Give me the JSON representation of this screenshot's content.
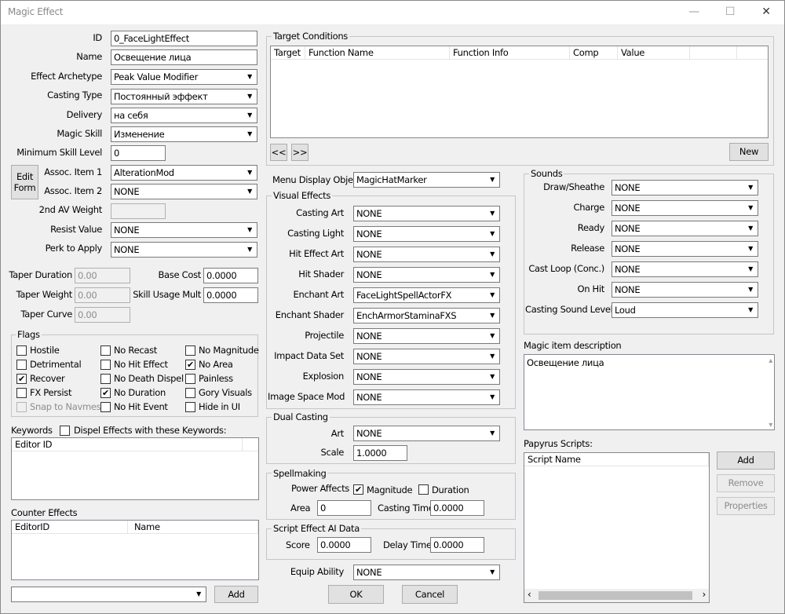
{
  "window": {
    "title": "Magic Effect",
    "minimize": "—",
    "maximize": "☐",
    "close": "✕"
  },
  "left": {
    "id_label": "ID",
    "id_value": "0_FaceLightEffect",
    "name_label": "Name",
    "name_value": "Освещение лица",
    "archetype_label": "Effect Archetype",
    "archetype_value": "Peak Value Modifier",
    "casting_type_label": "Casting Type",
    "casting_type_value": "Постоянный эффект",
    "delivery_label": "Delivery",
    "delivery_value": "на себя",
    "magic_skill_label": "Magic Skill",
    "magic_skill_value": "Изменение",
    "min_skill_label": "Minimum Skill Level",
    "min_skill_value": "0",
    "edit_form_line1": "Edit",
    "edit_form_line2": "Form",
    "assoc1_label": "Assoc. Item 1",
    "assoc1_value": "AlterationMod",
    "assoc2_label": "Assoc. Item 2",
    "assoc2_value": "NONE",
    "av_weight_label": "2nd AV Weight",
    "av_weight_value": "",
    "resist_label": "Resist Value",
    "resist_value": "NONE",
    "perk_label": "Perk to Apply",
    "perk_value": "NONE",
    "taper_duration_label": "Taper Duration",
    "taper_duration_value": "0.00",
    "taper_weight_label": "Taper Weight",
    "taper_weight_value": "0.00",
    "taper_curve_label": "Taper Curve",
    "taper_curve_value": "0.00",
    "base_cost_label": "Base Cost",
    "base_cost_value": "0.0000",
    "skill_mult_label": "Skill Usage Mult",
    "skill_mult_value": "0.0000"
  },
  "flags": {
    "title": "Flags",
    "items": [
      {
        "label": "Hostile",
        "checked": false,
        "disabled": false
      },
      {
        "label": "No Recast",
        "checked": false,
        "disabled": false
      },
      {
        "label": "No Magnitude",
        "checked": false,
        "disabled": false
      },
      {
        "label": "Detrimental",
        "checked": false,
        "disabled": false
      },
      {
        "label": "No Hit Effect",
        "checked": false,
        "disabled": false
      },
      {
        "label": "No Area",
        "checked": true,
        "disabled": false
      },
      {
        "label": "Recover",
        "checked": true,
        "disabled": false
      },
      {
        "label": "No Death Dispel",
        "checked": false,
        "disabled": false
      },
      {
        "label": "Painless",
        "checked": false,
        "disabled": false
      },
      {
        "label": "FX Persist",
        "checked": false,
        "disabled": false
      },
      {
        "label": "No Duration",
        "checked": true,
        "disabled": false
      },
      {
        "label": "Gory Visuals",
        "checked": false,
        "disabled": false
      },
      {
        "label": "Snap to Navmesh",
        "checked": false,
        "disabled": true
      },
      {
        "label": "No Hit Event",
        "checked": false,
        "disabled": false
      },
      {
        "label": "Hide in UI",
        "checked": false,
        "disabled": false
      }
    ]
  },
  "keywords": {
    "title": "Keywords",
    "dispel_label": "Dispel Effects with these Keywords:",
    "col_editor_id": "Editor ID"
  },
  "counter": {
    "title": "Counter Effects",
    "col_editor_id": "EditorID",
    "col_name": "Name",
    "add_label": "Add",
    "dropdown_value": ""
  },
  "target": {
    "title": "Target Conditions",
    "cols": [
      "Target",
      "Function Name",
      "Function Info",
      "Comp",
      "Value"
    ],
    "prev": "<<",
    "next": ">>",
    "new_label": "New"
  },
  "menu_display": {
    "label": "Menu Display Object",
    "value": "MagicHatMarker"
  },
  "visual": {
    "title": "Visual Effects",
    "rows": [
      {
        "label": "Casting Art",
        "value": "NONE"
      },
      {
        "label": "Casting Light",
        "value": "NONE"
      },
      {
        "label": "Hit Effect Art",
        "value": "NONE"
      },
      {
        "label": "Hit Shader",
        "value": "NONE"
      },
      {
        "label": "Enchant Art",
        "value": "FaceLightSpellActorFX"
      },
      {
        "label": "Enchant Shader",
        "value": "EnchArmorStaminaFXS"
      },
      {
        "label": "Projectile",
        "value": "NONE"
      },
      {
        "label": "Impact Data Set",
        "value": "NONE"
      },
      {
        "label": "Explosion",
        "value": "NONE"
      },
      {
        "label": "Image Space Mod",
        "value": "NONE"
      }
    ]
  },
  "dual": {
    "title": "Dual Casting",
    "art_label": "Art",
    "art_value": "NONE",
    "scale_label": "Scale",
    "scale_value": "1.0000"
  },
  "spellmaking": {
    "title": "Spellmaking",
    "power_label": "Power Affects",
    "magnitude_label": "Magnitude",
    "magnitude_checked": true,
    "duration_label": "Duration",
    "duration_checked": false,
    "area_label": "Area",
    "area_value": "0",
    "casting_time_label": "Casting Time",
    "casting_time_value": "0.0000"
  },
  "script_ai": {
    "title": "Script Effect AI Data",
    "score_label": "Score",
    "score_value": "0.0000",
    "delay_label": "Delay Time",
    "delay_value": "0.0000"
  },
  "equip": {
    "label": "Equip Ability",
    "value": "NONE"
  },
  "buttons": {
    "ok": "OK",
    "cancel": "Cancel"
  },
  "sounds": {
    "title": "Sounds",
    "rows": [
      {
        "label": "Draw/Sheathe",
        "value": "NONE"
      },
      {
        "label": "Charge",
        "value": "NONE"
      },
      {
        "label": "Ready",
        "value": "NONE"
      },
      {
        "label": "Release",
        "value": "NONE"
      },
      {
        "label": "Cast Loop (Conc.)",
        "value": "NONE"
      },
      {
        "label": "On Hit",
        "value": "NONE"
      }
    ],
    "level_label": "Casting Sound Level",
    "level_value": "Loud"
  },
  "description": {
    "label": "Magic item description",
    "value": "Освещение лица"
  },
  "papyrus": {
    "label": "Papyrus Scripts:",
    "col_script": "Script Name",
    "add": "Add",
    "remove": "Remove",
    "properties": "Properties"
  },
  "icons": {
    "dropdown_arrow": "▼",
    "check": "✔",
    "scroll_up": "▴",
    "scroll_down": "▾",
    "scroll_left": "‹",
    "scroll_right": "›"
  }
}
